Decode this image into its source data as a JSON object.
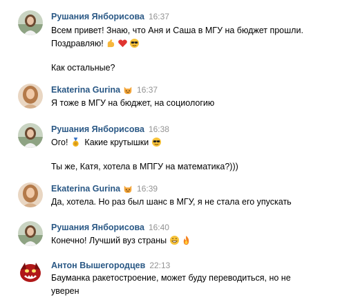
{
  "messages": [
    {
      "author": "Рушания Янборисова",
      "time": "16:37",
      "avatar_icon": "girl-photo-icon",
      "lines": {
        "l1": "Всем привет! Знаю, что Аня и Саша в МГУ на бюджет прошли.",
        "l2": "Поздравляю!",
        "l3": "Как остальные?"
      }
    },
    {
      "author": "Ekaterina Gurina",
      "time": "16:37",
      "avatar_icon": "woman-photo-icon",
      "badge_icon": "cat-emoji-icon",
      "lines": {
        "l1": "Я тоже в МГУ на бюджет, на социологию"
      }
    },
    {
      "author": "Рушания Янборисова",
      "time": "16:38",
      "avatar_icon": "girl-photo-icon",
      "lines": {
        "l1a": "Ого!",
        "l1b": "Какие крутышки",
        "l2": "Ты же, Катя, хотела в МПГУ на математика?)))"
      }
    },
    {
      "author": "Ekaterina Gurina",
      "time": "16:39",
      "avatar_icon": "woman-photo-icon",
      "badge_icon": "cat-emoji-icon",
      "lines": {
        "l1": "Да, хотела. Но раз был шанс в МГУ, я не стала его упускать"
      }
    },
    {
      "author": "Рушания Янборисова",
      "time": "16:40",
      "avatar_icon": "girl-photo-icon",
      "lines": {
        "l1": "Конечно! Лучший вуз страны"
      }
    },
    {
      "author": "Антон Вышегородцев",
      "time": "22:13",
      "avatar_icon": "red-monster-avatar-icon",
      "lines": {
        "l1": "Бауманка ракетостроение, может буду переводиться, но не",
        "l2": "уверен"
      }
    }
  ],
  "colors": {
    "author": "#2a5885",
    "time": "#939393",
    "text": "#000000",
    "background": "#ffffff"
  }
}
